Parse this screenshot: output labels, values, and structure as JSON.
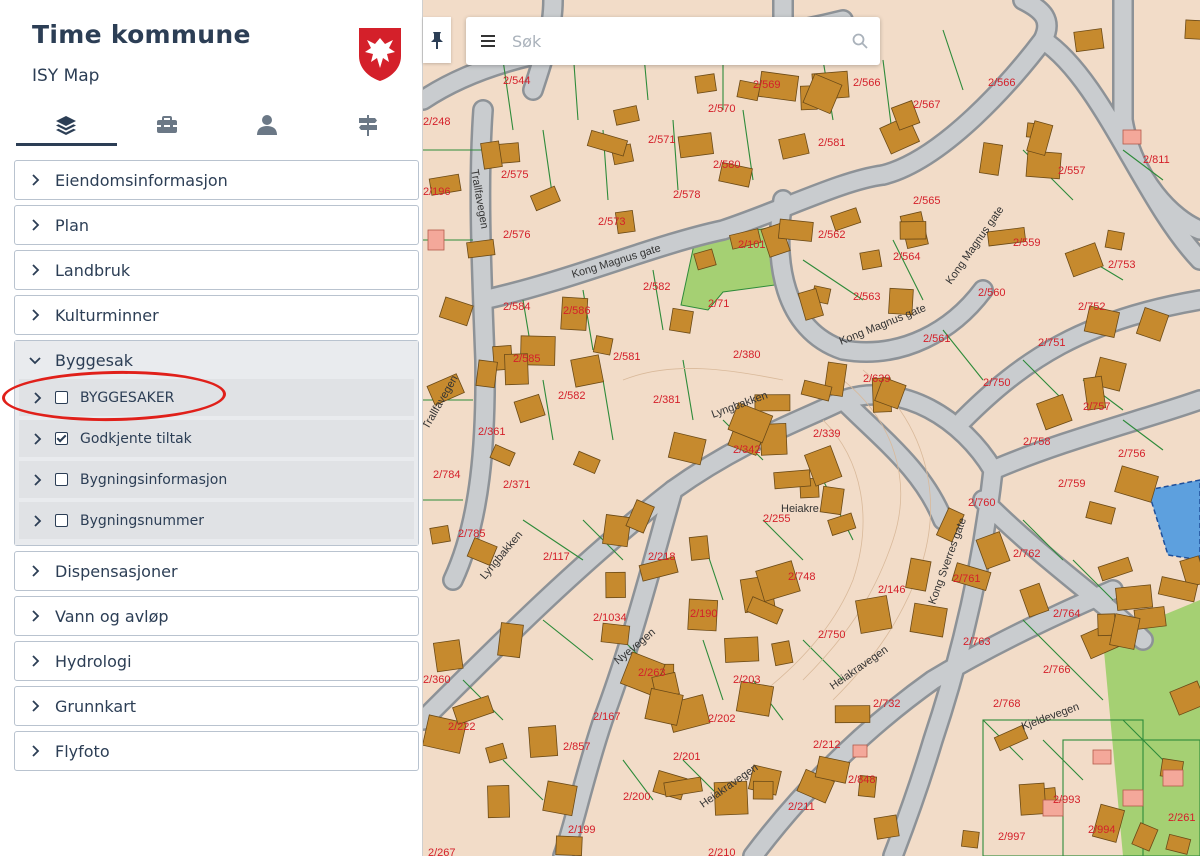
{
  "app": {
    "title": "Time kommune",
    "subtitle": "ISY Map"
  },
  "tabs": [
    {
      "name": "layers",
      "icon": "layers-icon",
      "active": true
    },
    {
      "name": "tools",
      "icon": "toolbox-icon",
      "active": false
    },
    {
      "name": "user",
      "icon": "user-icon",
      "active": false
    },
    {
      "name": "signpost",
      "icon": "signpost-icon",
      "active": false
    }
  ],
  "groups": [
    {
      "label": "Eiendomsinformasjon",
      "expanded": false
    },
    {
      "label": "Plan",
      "expanded": false
    },
    {
      "label": "Landbruk",
      "expanded": false
    },
    {
      "label": "Kulturminner",
      "expanded": false
    },
    {
      "label": "Byggesak",
      "expanded": true
    },
    {
      "label": "Dispensasjoner",
      "expanded": false
    },
    {
      "label": "Vann og avløp",
      "expanded": false
    },
    {
      "label": "Hydrologi",
      "expanded": false
    },
    {
      "label": "Grunnkart",
      "expanded": false
    },
    {
      "label": "Flyfoto",
      "expanded": false
    }
  ],
  "byggesak_layers": [
    {
      "label": "BYGGESAKER",
      "checked": false
    },
    {
      "label": "Godkjente tiltak",
      "checked": true
    },
    {
      "label": "Bygningsinformasjon",
      "checked": false
    },
    {
      "label": "Bygningsnummer",
      "checked": false
    }
  ],
  "search": {
    "placeholder": "Søk"
  },
  "map": {
    "colors": {
      "background": "#f2dcc8",
      "road": "#9ea3a8",
      "road_fill": "#c9cccf",
      "building": "#c68a2e",
      "building_stroke": "#6b4a17",
      "parcel_line": "#2e8b3a",
      "label": "#d4202a",
      "green_area": "#a5d073",
      "water": "#5da0de"
    },
    "street_names": [
      "Trallfavegen",
      "Kong Magnus gate",
      "Lyngbakken",
      "Kong Sverres gate",
      "Nyevegen",
      "Heiakravegen",
      "Kjeldevegen",
      "Heiakre"
    ],
    "parcel_labels": [
      "2/544",
      "2/569",
      "2/566",
      "2/567",
      "2/566",
      "2/570",
      "2/571",
      "2/580",
      "2/581",
      "2/575",
      "2/578",
      "2/573",
      "2/576",
      "2/562",
      "2/565",
      "2/559",
      "2/557",
      "2/101",
      "2/564",
      "2/563",
      "2/560",
      "2/753",
      "2/582",
      "2/584",
      "2/586",
      "2/71",
      "2/561",
      "2/751",
      "2/752",
      "2/585",
      "2/581",
      "2/380",
      "2/639",
      "2/750",
      "2/582",
      "2/381",
      "2/757",
      "2/361",
      "2/342",
      "2/339",
      "2/758",
      "2/756",
      "2/784",
      "2/371",
      "2/255",
      "2/759",
      "2/760",
      "2/785",
      "2/117",
      "2/218",
      "2/762",
      "2/761",
      "2/748",
      "2/146",
      "2/1034",
      "2/190",
      "2/764",
      "2/763",
      "2/750",
      "2/263",
      "2/203",
      "2/732",
      "2/766",
      "2/768",
      "2/222",
      "2/167",
      "2/202",
      "2/212",
      "2/857",
      "2/201",
      "2/848",
      "2/993",
      "2/200",
      "2/211",
      "2/199",
      "2/997",
      "2/994",
      "2/261",
      "2/267",
      "2/210",
      "2/811",
      "2/248",
      "2/196",
      "2/360"
    ]
  }
}
